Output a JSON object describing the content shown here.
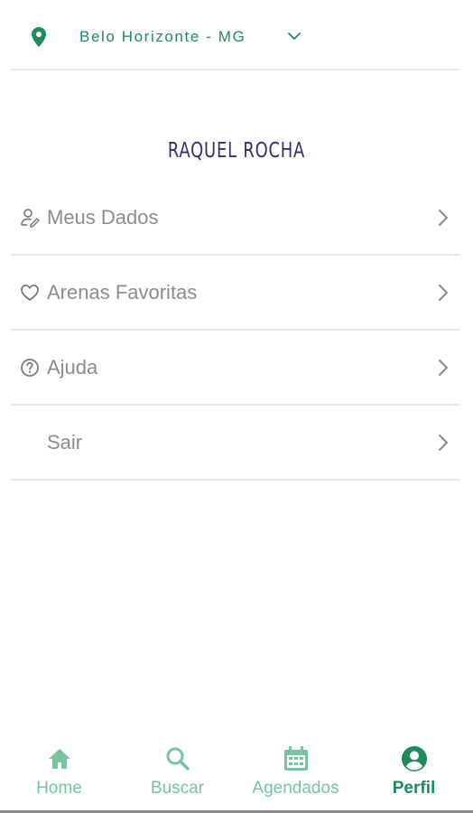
{
  "header": {
    "location": "Belo Horizonte - MG",
    "icons": {
      "pin": "map-pin-icon",
      "dropdown": "chevron-down-icon"
    }
  },
  "profile": {
    "name": "RAQUEL ROCHA"
  },
  "menu": {
    "items": [
      {
        "label": "Meus Dados",
        "icon": "user-edit-icon"
      },
      {
        "label": "Arenas Favoritas",
        "icon": "heart-icon"
      },
      {
        "label": "Ajuda",
        "icon": "help-circle-icon"
      },
      {
        "label": "Sair",
        "icon": ""
      }
    ]
  },
  "bottom_nav": {
    "items": [
      {
        "label": "Home",
        "icon": "home-icon",
        "active": false
      },
      {
        "label": "Buscar",
        "icon": "search-icon",
        "active": false
      },
      {
        "label": "Agendados",
        "icon": "calendar-icon",
        "active": false
      },
      {
        "label": "Perfil",
        "icon": "profile-icon",
        "active": true
      }
    ]
  },
  "colors": {
    "accent": "#1f8a5e",
    "accent_light": "#78c4a0",
    "name_color": "#3a2a6e",
    "menu_text": "#8c8c8c",
    "divider": "#e8e8e8"
  }
}
